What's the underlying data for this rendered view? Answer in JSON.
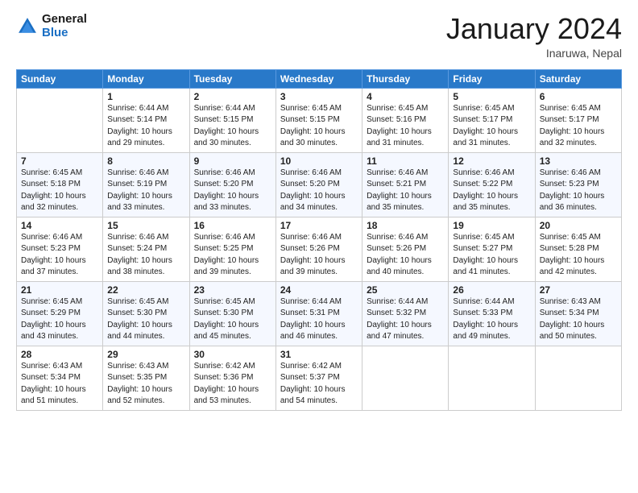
{
  "header": {
    "logo_general": "General",
    "logo_blue": "Blue",
    "month_title": "January 2024",
    "location": "Inaruwa, Nepal"
  },
  "weekdays": [
    "Sunday",
    "Monday",
    "Tuesday",
    "Wednesday",
    "Thursday",
    "Friday",
    "Saturday"
  ],
  "weeks": [
    [
      {
        "day": "",
        "sunrise": "",
        "sunset": "",
        "daylight": ""
      },
      {
        "day": "1",
        "sunrise": "Sunrise: 6:44 AM",
        "sunset": "Sunset: 5:14 PM",
        "daylight": "Daylight: 10 hours and 29 minutes."
      },
      {
        "day": "2",
        "sunrise": "Sunrise: 6:44 AM",
        "sunset": "Sunset: 5:15 PM",
        "daylight": "Daylight: 10 hours and 30 minutes."
      },
      {
        "day": "3",
        "sunrise": "Sunrise: 6:45 AM",
        "sunset": "Sunset: 5:15 PM",
        "daylight": "Daylight: 10 hours and 30 minutes."
      },
      {
        "day": "4",
        "sunrise": "Sunrise: 6:45 AM",
        "sunset": "Sunset: 5:16 PM",
        "daylight": "Daylight: 10 hours and 31 minutes."
      },
      {
        "day": "5",
        "sunrise": "Sunrise: 6:45 AM",
        "sunset": "Sunset: 5:17 PM",
        "daylight": "Daylight: 10 hours and 31 minutes."
      },
      {
        "day": "6",
        "sunrise": "Sunrise: 6:45 AM",
        "sunset": "Sunset: 5:17 PM",
        "daylight": "Daylight: 10 hours and 32 minutes."
      }
    ],
    [
      {
        "day": "7",
        "sunrise": "Sunrise: 6:45 AM",
        "sunset": "Sunset: 5:18 PM",
        "daylight": "Daylight: 10 hours and 32 minutes."
      },
      {
        "day": "8",
        "sunrise": "Sunrise: 6:46 AM",
        "sunset": "Sunset: 5:19 PM",
        "daylight": "Daylight: 10 hours and 33 minutes."
      },
      {
        "day": "9",
        "sunrise": "Sunrise: 6:46 AM",
        "sunset": "Sunset: 5:20 PM",
        "daylight": "Daylight: 10 hours and 33 minutes."
      },
      {
        "day": "10",
        "sunrise": "Sunrise: 6:46 AM",
        "sunset": "Sunset: 5:20 PM",
        "daylight": "Daylight: 10 hours and 34 minutes."
      },
      {
        "day": "11",
        "sunrise": "Sunrise: 6:46 AM",
        "sunset": "Sunset: 5:21 PM",
        "daylight": "Daylight: 10 hours and 35 minutes."
      },
      {
        "day": "12",
        "sunrise": "Sunrise: 6:46 AM",
        "sunset": "Sunset: 5:22 PM",
        "daylight": "Daylight: 10 hours and 35 minutes."
      },
      {
        "day": "13",
        "sunrise": "Sunrise: 6:46 AM",
        "sunset": "Sunset: 5:23 PM",
        "daylight": "Daylight: 10 hours and 36 minutes."
      }
    ],
    [
      {
        "day": "14",
        "sunrise": "Sunrise: 6:46 AM",
        "sunset": "Sunset: 5:23 PM",
        "daylight": "Daylight: 10 hours and 37 minutes."
      },
      {
        "day": "15",
        "sunrise": "Sunrise: 6:46 AM",
        "sunset": "Sunset: 5:24 PM",
        "daylight": "Daylight: 10 hours and 38 minutes."
      },
      {
        "day": "16",
        "sunrise": "Sunrise: 6:46 AM",
        "sunset": "Sunset: 5:25 PM",
        "daylight": "Daylight: 10 hours and 39 minutes."
      },
      {
        "day": "17",
        "sunrise": "Sunrise: 6:46 AM",
        "sunset": "Sunset: 5:26 PM",
        "daylight": "Daylight: 10 hours and 39 minutes."
      },
      {
        "day": "18",
        "sunrise": "Sunrise: 6:46 AM",
        "sunset": "Sunset: 5:26 PM",
        "daylight": "Daylight: 10 hours and 40 minutes."
      },
      {
        "day": "19",
        "sunrise": "Sunrise: 6:45 AM",
        "sunset": "Sunset: 5:27 PM",
        "daylight": "Daylight: 10 hours and 41 minutes."
      },
      {
        "day": "20",
        "sunrise": "Sunrise: 6:45 AM",
        "sunset": "Sunset: 5:28 PM",
        "daylight": "Daylight: 10 hours and 42 minutes."
      }
    ],
    [
      {
        "day": "21",
        "sunrise": "Sunrise: 6:45 AM",
        "sunset": "Sunset: 5:29 PM",
        "daylight": "Daylight: 10 hours and 43 minutes."
      },
      {
        "day": "22",
        "sunrise": "Sunrise: 6:45 AM",
        "sunset": "Sunset: 5:30 PM",
        "daylight": "Daylight: 10 hours and 44 minutes."
      },
      {
        "day": "23",
        "sunrise": "Sunrise: 6:45 AM",
        "sunset": "Sunset: 5:30 PM",
        "daylight": "Daylight: 10 hours and 45 minutes."
      },
      {
        "day": "24",
        "sunrise": "Sunrise: 6:44 AM",
        "sunset": "Sunset: 5:31 PM",
        "daylight": "Daylight: 10 hours and 46 minutes."
      },
      {
        "day": "25",
        "sunrise": "Sunrise: 6:44 AM",
        "sunset": "Sunset: 5:32 PM",
        "daylight": "Daylight: 10 hours and 47 minutes."
      },
      {
        "day": "26",
        "sunrise": "Sunrise: 6:44 AM",
        "sunset": "Sunset: 5:33 PM",
        "daylight": "Daylight: 10 hours and 49 minutes."
      },
      {
        "day": "27",
        "sunrise": "Sunrise: 6:43 AM",
        "sunset": "Sunset: 5:34 PM",
        "daylight": "Daylight: 10 hours and 50 minutes."
      }
    ],
    [
      {
        "day": "28",
        "sunrise": "Sunrise: 6:43 AM",
        "sunset": "Sunset: 5:34 PM",
        "daylight": "Daylight: 10 hours and 51 minutes."
      },
      {
        "day": "29",
        "sunrise": "Sunrise: 6:43 AM",
        "sunset": "Sunset: 5:35 PM",
        "daylight": "Daylight: 10 hours and 52 minutes."
      },
      {
        "day": "30",
        "sunrise": "Sunrise: 6:42 AM",
        "sunset": "Sunset: 5:36 PM",
        "daylight": "Daylight: 10 hours and 53 minutes."
      },
      {
        "day": "31",
        "sunrise": "Sunrise: 6:42 AM",
        "sunset": "Sunset: 5:37 PM",
        "daylight": "Daylight: 10 hours and 54 minutes."
      },
      {
        "day": "",
        "sunrise": "",
        "sunset": "",
        "daylight": ""
      },
      {
        "day": "",
        "sunrise": "",
        "sunset": "",
        "daylight": ""
      },
      {
        "day": "",
        "sunrise": "",
        "sunset": "",
        "daylight": ""
      }
    ]
  ]
}
